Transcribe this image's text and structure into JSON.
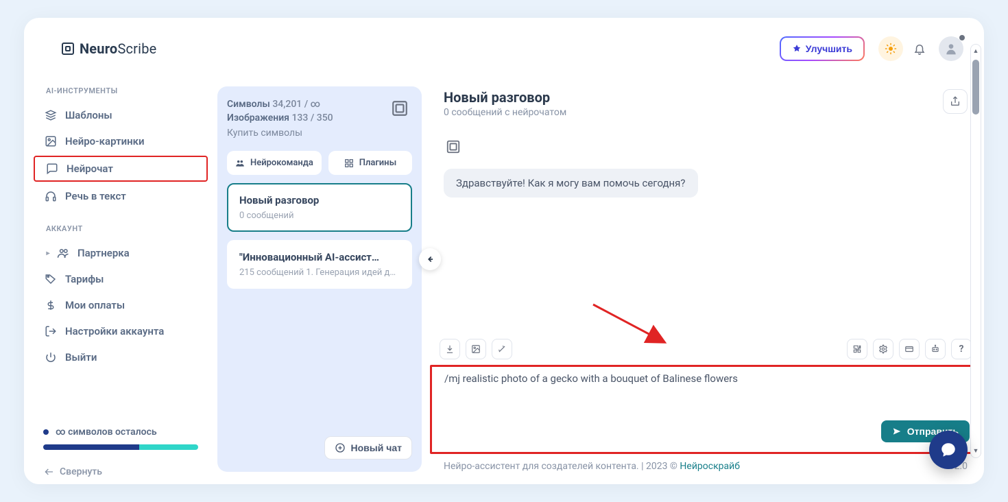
{
  "brand": {
    "part1": "Neuro",
    "part2": "Scribe"
  },
  "topbar": {
    "upgrade_label": "Улучшить"
  },
  "sidebar": {
    "section_tools": "AI-ИНСТРУМЕНТЫ",
    "section_account": "АККАУНТ",
    "items_tools": [
      {
        "label": "Шаблоны",
        "icon": "stack"
      },
      {
        "label": "Нейро-картинки",
        "icon": "image"
      },
      {
        "label": "Нейрочат",
        "icon": "chat",
        "highlight": true
      },
      {
        "label": "Речь в текст",
        "icon": "headphones"
      }
    ],
    "items_account": [
      {
        "label": "Партнерка",
        "icon": "users",
        "expandable": true
      },
      {
        "label": "Тарифы",
        "icon": "tag"
      },
      {
        "label": "Мои оплаты",
        "icon": "dollar"
      },
      {
        "label": "Настройки аккаунта",
        "icon": "exit"
      },
      {
        "label": "Выйти",
        "icon": "power"
      }
    ],
    "symbols_text": "∞ символов осталось",
    "collapse_label": "Свернуть"
  },
  "panel": {
    "stats": {
      "symbols_label": "Символы",
      "symbols_value": "34,201 / ∞",
      "images_label": "Изображения",
      "images_value": "133 / 350",
      "buy_label": "Купить символы"
    },
    "chips": {
      "team_label": "Нейрокоманда",
      "plugins_label": "Плагины"
    },
    "chats": [
      {
        "title": "Новый разговор",
        "sub": "0 сообщений",
        "active": true
      },
      {
        "title": "\"Инновационный AI-ассист…",
        "sub": "215 сообщений 1. Генерация идей дл…",
        "active": false
      }
    ],
    "new_chat_label": "Новый чат"
  },
  "chat": {
    "title": "Новый разговор",
    "sub": "0 сообщений с нейрочатом",
    "greeting": "Здравствуйте! Как я могу вам помочь сегодня?",
    "composer_value": "/mj realistic photo of a gecko with a bouquet of Balinese flowers",
    "send_label": "Отправить"
  },
  "footer": {
    "text": "Нейро-ассистент для создателей контента.  |  2023 © ",
    "brand": "Нейроскрайб",
    "version": "v2.0"
  }
}
